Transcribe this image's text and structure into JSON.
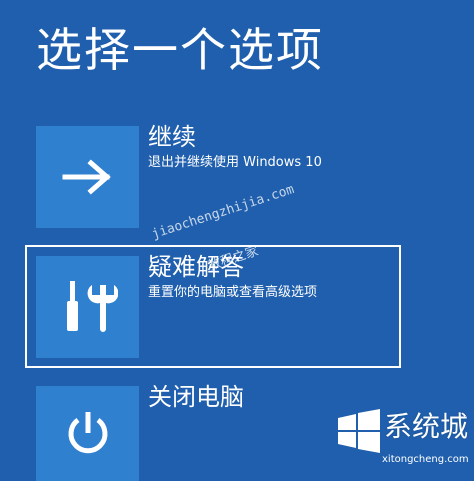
{
  "page": {
    "title": "选择一个选项"
  },
  "options": [
    {
      "title": "继续",
      "description": "退出并继续使用 Windows 10",
      "icon": "arrow-right-icon"
    },
    {
      "title": "疑难解答",
      "description": "重置你的电脑或查看高级选项",
      "icon": "tools-icon"
    },
    {
      "title": "关闭电脑",
      "description": "",
      "icon": "power-icon"
    }
  ],
  "watermarks": {
    "top_url": "jiaochengzhijia.com",
    "top_label": "教程之家",
    "brand_name": "系统城",
    "brand_url": "xitongcheng.com"
  },
  "colors": {
    "background": "#1f5fad",
    "tile": "#2f80cf",
    "text": "#ffffff"
  }
}
